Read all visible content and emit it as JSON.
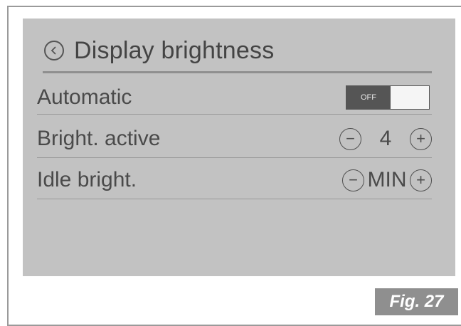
{
  "header": {
    "title": "Display brightness",
    "back_icon": "chevron-left-icon"
  },
  "rows": [
    {
      "label": "Automatic",
      "toggle_state": "OFF"
    },
    {
      "label": "Bright. active",
      "value": "4",
      "minus": "−",
      "plus": "+"
    },
    {
      "label": "Idle bright.",
      "value": "MIN",
      "minus": "−",
      "plus": "+"
    }
  ],
  "figure_label": "Fig. 27"
}
